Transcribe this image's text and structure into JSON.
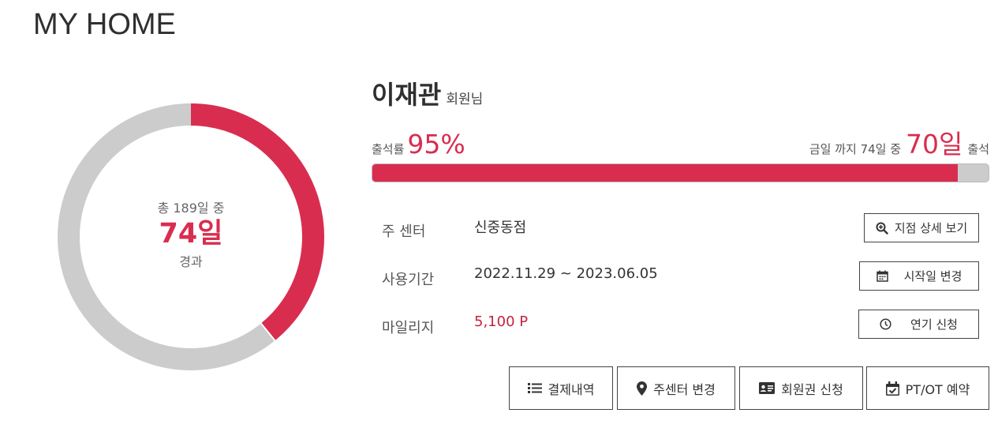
{
  "page": {
    "title": "MY HOME"
  },
  "colors": {
    "accent": "#d92d4f",
    "track": "#cccccc"
  },
  "progress_ring": {
    "total_text": "총 189일 중",
    "elapsed_text": "74일",
    "caption": "경과",
    "total_days": 189,
    "elapsed_days": 74
  },
  "member": {
    "name": "이재관",
    "suffix": "회원님"
  },
  "attendance": {
    "rate_label": "출석률",
    "rate_value": "95%",
    "rate_fraction": 0.95,
    "until_text": "금일 까지 74일 중",
    "attended_value": "70일",
    "attended_suffix": "출석"
  },
  "info": {
    "center": {
      "label": "주 센터",
      "value": "신중동점",
      "button": "지점 상세 보기",
      "icon": "zoom-in-icon"
    },
    "period": {
      "label": "사용기간",
      "value": "2022.11.29 ~ 2023.06.05",
      "button": "시작일 변경",
      "icon": "calendar-icon"
    },
    "mileage": {
      "label": "마일리지",
      "value": "5,100 P",
      "button": "연기 신청",
      "icon": "clock-icon"
    }
  },
  "actions": [
    {
      "label": "결제내역",
      "icon": "list-icon"
    },
    {
      "label": "주센터 변경",
      "icon": "map-marker-icon"
    },
    {
      "label": "회원권 신청",
      "icon": "id-card-icon"
    },
    {
      "label": "PT/OT 예약",
      "icon": "calendar-check-icon"
    }
  ]
}
